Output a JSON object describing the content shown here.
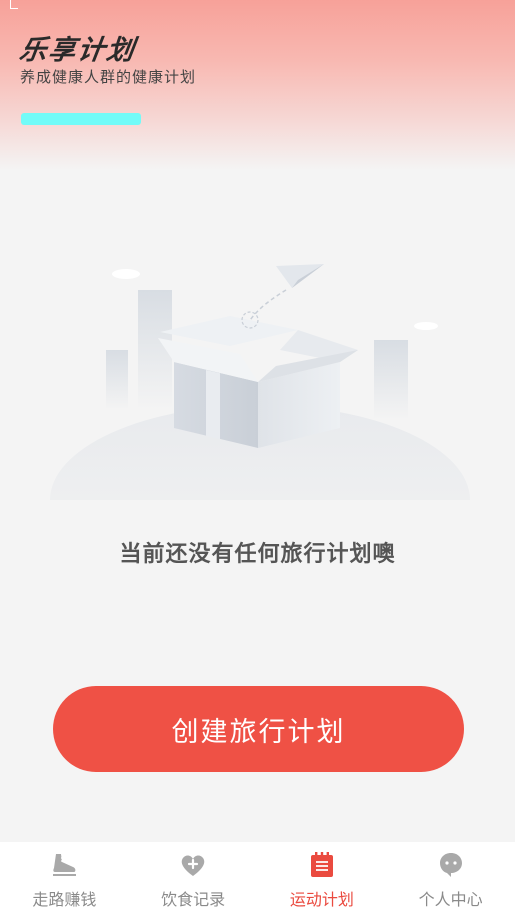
{
  "header": {
    "title": "乐享计划",
    "subtitle": "养成健康人群的健康计划"
  },
  "empty_state": {
    "message": "当前还没有任何旅行计划噢"
  },
  "actions": {
    "create_plan_label": "创建旅行计划"
  },
  "tabbar": {
    "active_index": 2,
    "tabs": [
      {
        "label": "走路赚钱",
        "icon": "shoe-icon"
      },
      {
        "label": "饮食记录",
        "icon": "heart-plus-icon"
      },
      {
        "label": "运动计划",
        "icon": "notepad-icon"
      },
      {
        "label": "个人中心",
        "icon": "chat-bubble-icon"
      }
    ]
  },
  "colors": {
    "accent": "#ef5145",
    "active_tab": "#ea4a3f",
    "inactive_tab": "#8a8a8a",
    "header_top": "#f7a199",
    "accent_bar": "#72fbf8"
  }
}
